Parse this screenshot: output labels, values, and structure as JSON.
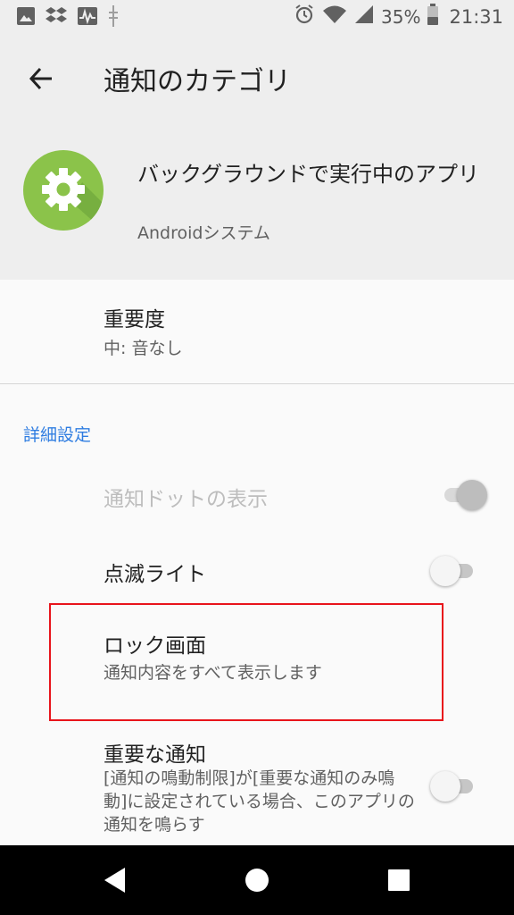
{
  "status_bar": {
    "battery_percent": "35%",
    "time": "21:31",
    "icons_left": [
      "image-icon",
      "dropbox-icon",
      "activity-icon",
      "usb-icon"
    ],
    "icons_right": [
      "alarm-icon",
      "wifi-icon",
      "signal-icon",
      "battery-icon"
    ]
  },
  "header": {
    "title": "通知のカテゴリ",
    "app_name": "バックグラウンドで実行中のアプリ",
    "app_subtitle": "Androidシステム",
    "app_icon": "gear-icon",
    "app_icon_color": "#8bc34a"
  },
  "importance": {
    "title": "重要度",
    "value": "中: 音なし"
  },
  "advanced": {
    "section_title": "詳細設定",
    "items": [
      {
        "title": "通知ドットの表示",
        "toggle": true,
        "disabled": true
      },
      {
        "title": "点滅ライト",
        "toggle": false
      },
      {
        "title": "ロック画面",
        "subtitle": "通知内容をすべて表示します"
      },
      {
        "title": "重要な通知",
        "subtitle": "[通知の鳴動制限]が[重要な通知のみ鳴動]に設定されている場合、このアプリの通知を鳴らす",
        "toggle": false
      }
    ]
  },
  "colors": {
    "accent": "#2f7de1",
    "highlight": "#e8141b"
  }
}
